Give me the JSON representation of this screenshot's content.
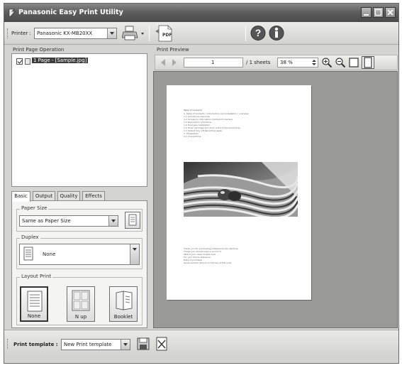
{
  "window": {
    "title": "Panasonic Easy Print Utility",
    "controls": [
      "minimize",
      "maximize",
      "close"
    ]
  },
  "toolbar": {
    "printer_label": "Printer :",
    "printer_value": "Panasonic KX-MB20XX",
    "pdf_label": "PDF",
    "icons": [
      "print-icon",
      "pdf-icon",
      "help-icon",
      "info-icon"
    ]
  },
  "left_panel": {
    "title": "Print Page Operation",
    "items": [
      {
        "label": "1 Page - [Sample.jpg]",
        "checked": true,
        "selected": true
      }
    ]
  },
  "tabs": [
    {
      "label": "Basic",
      "active": true
    },
    {
      "label": "Output",
      "active": false
    },
    {
      "label": "Quality",
      "active": false
    },
    {
      "label": "Effects",
      "active": false
    }
  ],
  "basic": {
    "paper_size": {
      "title": "Paper Size",
      "value": "Same as Paper Size"
    },
    "duplex": {
      "title": "Duplex",
      "value": "None"
    },
    "layout_print": {
      "title": "Layout Print",
      "options": [
        {
          "label": "None",
          "selected": true
        },
        {
          "label": "N up",
          "selected": false
        },
        {
          "label": "Booklet",
          "selected": false
        }
      ]
    }
  },
  "preview": {
    "title": "Print Preview",
    "page_number": "1",
    "sheets_label": "/ 1 sheets",
    "zoom": "38 %",
    "document": {
      "heading": "Table of Contents",
      "lines": [
        "1. Table of Contents / Introduction and installation / overview",
        "1.1 Included accessories",
        "1.2 Accessory information (Unit/print) Camera",
        "1.3 Description of buttons",
        "1.4 Overview installation",
        "1.5 Toner cartridge and drum unit      1.6 Document tray",
        "1.7 Output tray                         1.8 Recording paper",
        "2. Preparation",
        "2.1 Connections"
      ],
      "footer_lines": [
        "Thank you for purchasing a Panasonic fax machine.",
        "Things you should keep a record of",
        "Attach your sales receipt here.",
        "For your future reference",
        "Date of purchase",
        "Serial number (found on the rear of the unit)"
      ]
    }
  },
  "bottom": {
    "template_label": "Print template :",
    "template_value": "New Print template"
  }
}
